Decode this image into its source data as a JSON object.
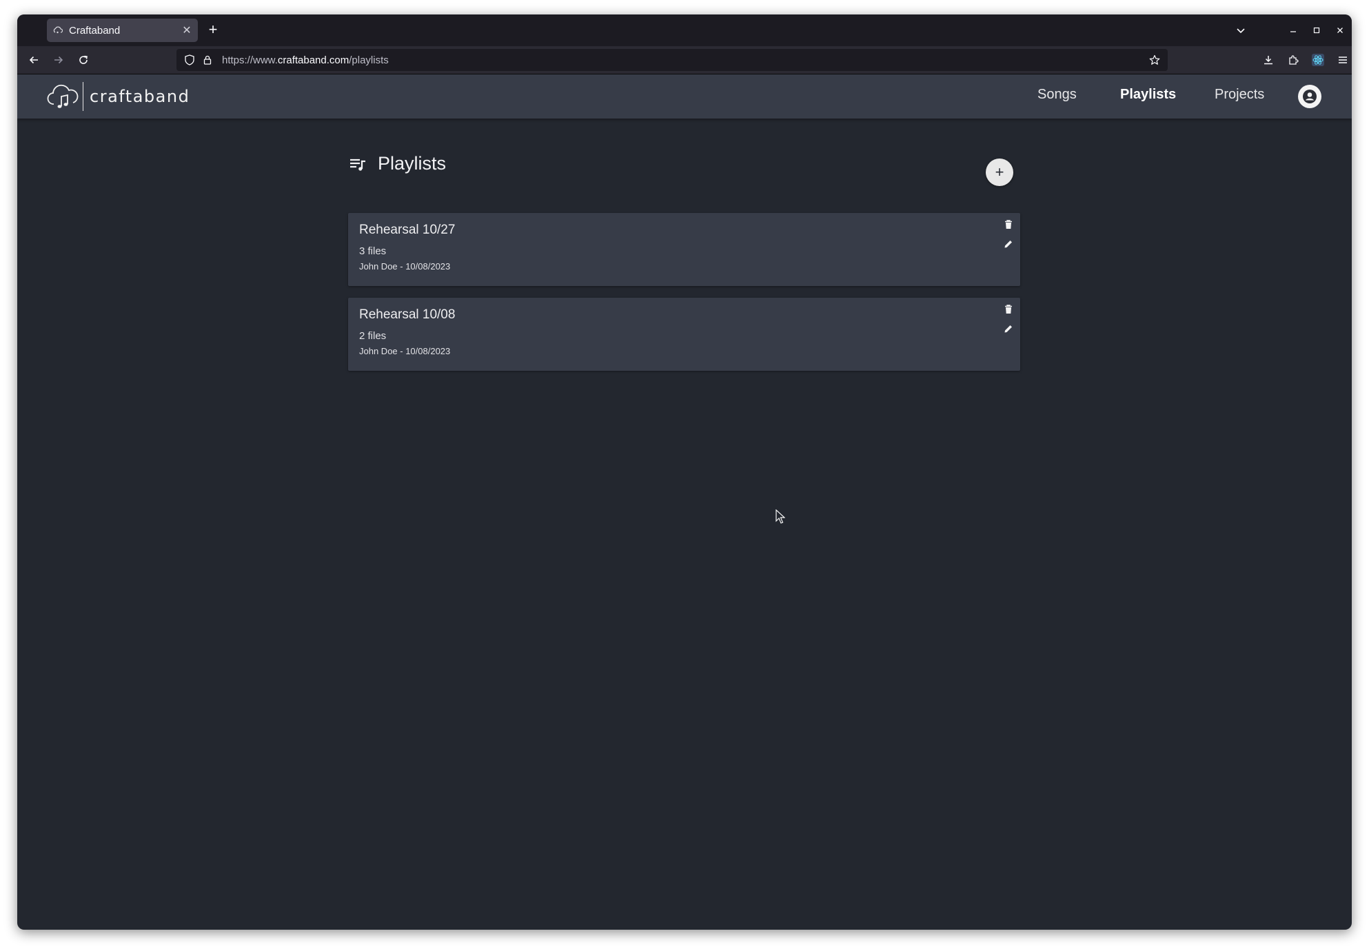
{
  "browser": {
    "tab_title": "Craftaband",
    "url_prefix": "https://www.",
    "url_domain": "craftaband.com",
    "url_path": "/playlists"
  },
  "app": {
    "logo_text": "craftaband",
    "nav": [
      {
        "label": "Songs",
        "active": false
      },
      {
        "label": "Playlists",
        "active": true
      },
      {
        "label": "Projects",
        "active": false
      }
    ]
  },
  "page": {
    "title": "Playlists",
    "add_label": "+",
    "playlists": [
      {
        "title": "Rehearsal 10/27",
        "files": "3 files",
        "meta": "John Doe - 10/08/2023"
      },
      {
        "title": "Rehearsal 10/08",
        "files": "2 files",
        "meta": "John Doe - 10/08/2023"
      }
    ]
  },
  "icons": {
    "favicon": "craftaband-favicon-icon",
    "back": "arrow-left-icon",
    "forward": "arrow-right-icon",
    "reload": "reload-icon",
    "shield": "shield-icon",
    "lock": "lock-icon",
    "star": "star-icon",
    "download": "download-icon",
    "extensions": "puzzle-icon",
    "menu": "hamburger-menu-icon",
    "playlist": "playlist-music-icon",
    "delete": "trash-icon",
    "edit": "pencil-icon",
    "account": "account-icon"
  },
  "colors": {
    "page_bg": "#23272f",
    "header_bg": "#373c48",
    "card_bg": "#373c48",
    "add_button_bg": "#e8e8e8"
  }
}
